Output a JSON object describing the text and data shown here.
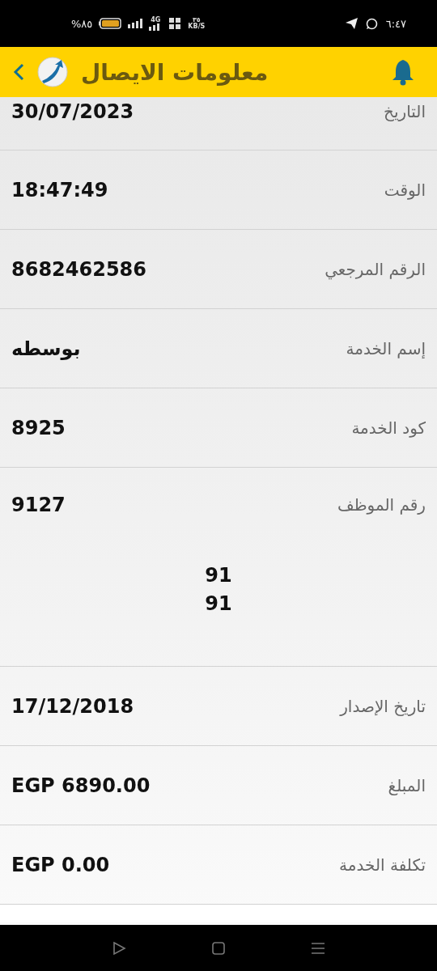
{
  "status_bar": {
    "battery_text": "%٨٥",
    "speed_value": "٣٥",
    "speed_unit": "KB/S",
    "network": "4G",
    "time": "٦:٤٧"
  },
  "header": {
    "title": "معلومات الايصال"
  },
  "rows": [
    {
      "label": "التاريخ",
      "value": "30/07/2023",
      "partial": true
    },
    {
      "label": "الوقت",
      "value": "18:47:49",
      "partial": false
    },
    {
      "label": "الرقم المرجعي",
      "value": "8682462586",
      "partial": false
    },
    {
      "label": "إسم الخدمة",
      "value": "بوسطه",
      "partial": false
    },
    {
      "label": "كود الخدمة",
      "value": "8925",
      "partial": false
    },
    {
      "label": "رقم الموظف",
      "value": "9127",
      "partial": false,
      "extra_lines": [
        "91",
        "91"
      ]
    },
    {
      "label": "تاريخ الإصدار",
      "value": "17/12/2018",
      "partial": false
    },
    {
      "label": "المبلغ",
      "value": "EGP 6890.00",
      "partial": false
    },
    {
      "label": "تكلفة الخدمة",
      "value": "EGP 0.00",
      "partial": false
    }
  ]
}
